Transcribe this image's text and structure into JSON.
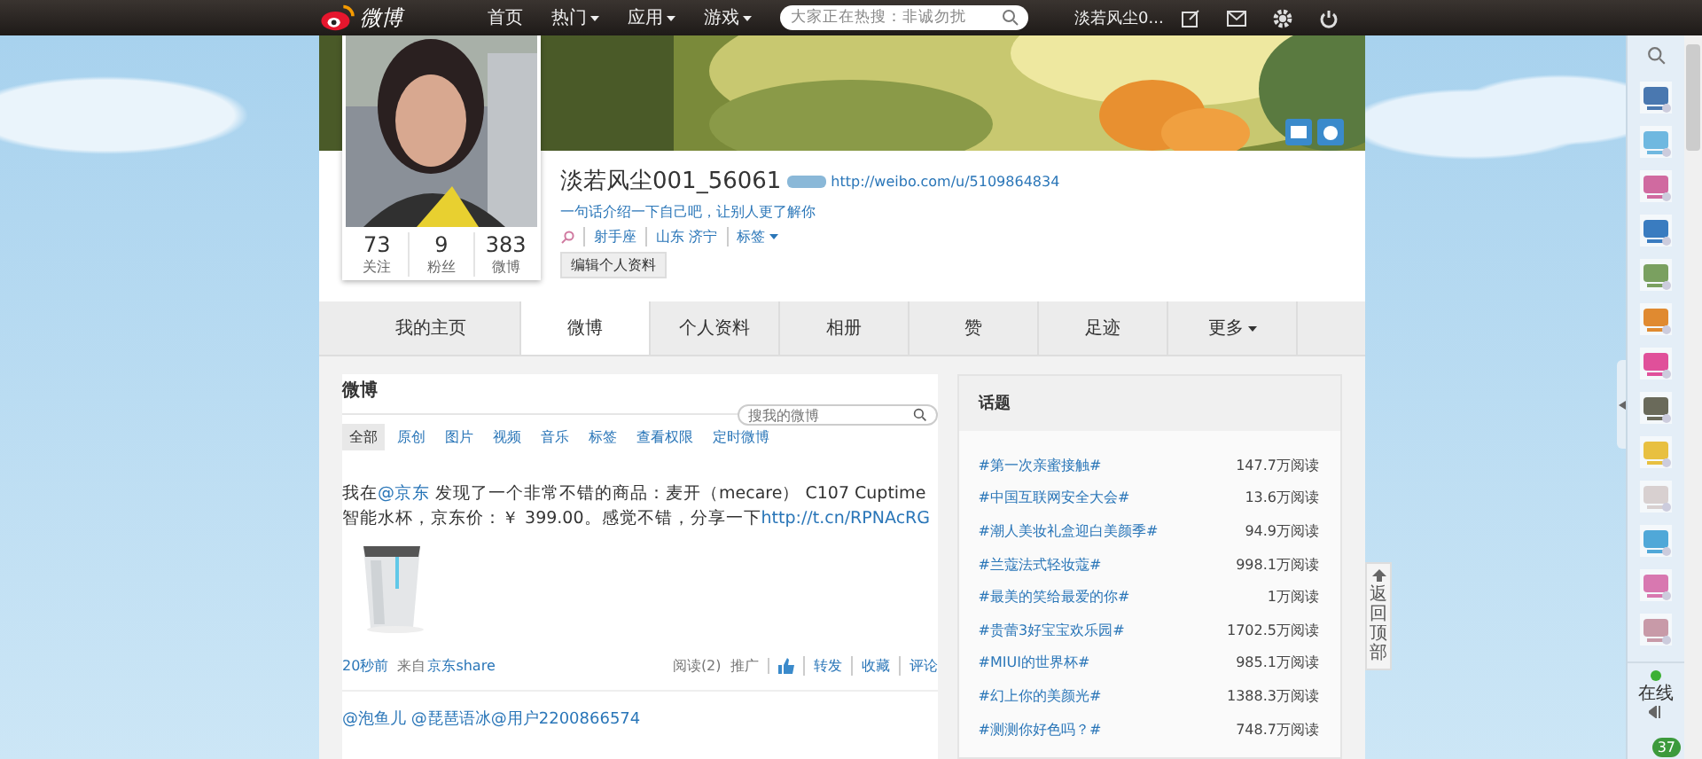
{
  "topbar": {
    "logo": "微博",
    "nav": [
      {
        "label": "首页",
        "dropdown": false
      },
      {
        "label": "热门",
        "dropdown": true
      },
      {
        "label": "应用",
        "dropdown": true
      },
      {
        "label": "游戏",
        "dropdown": true
      }
    ],
    "search": {
      "placeholder": "大家正在热搜：非诚勿扰"
    },
    "user": "淡若风尘0..."
  },
  "profile": {
    "name": "淡若风尘001_56061",
    "url": "http://weibo.com/u/5109864834",
    "bio": "一句话介绍一下自己吧，让别人更了解你",
    "details": [
      "射手座",
      "山东 济宁"
    ],
    "tags": "标签",
    "edit_button": "编辑个人资料",
    "stats": [
      {
        "value": "73",
        "label": "关注"
      },
      {
        "value": "9",
        "label": "粉丝"
      },
      {
        "value": "383",
        "label": "微博"
      }
    ]
  },
  "tabs": [
    {
      "label": "我的主页",
      "selected": false,
      "dropdown": false
    },
    {
      "label": "微博",
      "selected": true,
      "dropdown": false
    },
    {
      "label": "个人资料",
      "selected": false,
      "dropdown": false
    },
    {
      "label": "相册",
      "selected": false,
      "dropdown": false
    },
    {
      "label": "赞",
      "selected": false,
      "dropdown": false
    },
    {
      "label": "足迹",
      "selected": false,
      "dropdown": false
    },
    {
      "label": "更多",
      "selected": false,
      "dropdown": true
    }
  ],
  "feed": {
    "title": "微博",
    "search": {
      "placeholder": "搜我的微博"
    },
    "filters": [
      {
        "label": "全部",
        "selected": true
      },
      {
        "label": "原创",
        "selected": false
      },
      {
        "label": "图片",
        "selected": false
      },
      {
        "label": "视频",
        "selected": false
      },
      {
        "label": "音乐",
        "selected": false
      },
      {
        "label": "标签",
        "selected": false
      },
      {
        "label": "查看权限",
        "selected": false
      },
      {
        "label": "定时微博",
        "selected": false
      }
    ],
    "post": {
      "segments": [
        {
          "text": "我在",
          "link": false
        },
        {
          "text": "@京东",
          "link": true
        },
        {
          "text": " 发现了一个非常不错的商品：麦开（mecare） C107 Cuptime智能水杯，京东价：￥ 399.00。感觉不错，分享一下",
          "link": false
        },
        {
          "text": "http://t.cn/RPNAcRG",
          "link": true
        }
      ],
      "image": {
        "kind": "picture"
      },
      "time": "20秒前",
      "source_prefix": "来自",
      "source": "京东share",
      "reads": "阅读(2)",
      "promote": "推广",
      "actions": [
        "转发",
        "收藏",
        "评论"
      ]
    },
    "next_post": "@泡鱼儿 @琵琶语冰@用户2200866574"
  },
  "topics": {
    "title": "话题",
    "items": [
      {
        "name": "#第一次亲蜜接触#",
        "reads": "147.7万阅读"
      },
      {
        "name": "#中国互联网安全大会#",
        "reads": "13.6万阅读"
      },
      {
        "name": "#潮人美妆礼盒迎白美颜季#",
        "reads": "94.9万阅读"
      },
      {
        "name": "#兰蔻法式轻妆蔻#",
        "reads": "998.1万阅读"
      },
      {
        "name": "#最美的笑给最爱的你#",
        "reads": "1万阅读"
      },
      {
        "name": "#贵蕾3好宝宝欢乐园#",
        "reads": "1702.5万阅读"
      },
      {
        "name": "#MIUI的世界杯#",
        "reads": "985.1万阅读"
      },
      {
        "name": "#幻上你的美颜光#",
        "reads": "1388.3万阅读"
      },
      {
        "name": "#测测你好色吗？#",
        "reads": "748.7万阅读"
      }
    ]
  },
  "back_to_top": "返回顶部",
  "sidebar": {
    "apps": [
      {
        "color": "#4a78b0"
      },
      {
        "color": "#6fb8e0"
      },
      {
        "color": "#d06aa0"
      },
      {
        "color": "#3a7cc0"
      },
      {
        "color": "#7aa060"
      },
      {
        "color": "#e08a30"
      },
      {
        "color": "#e0509a"
      },
      {
        "color": "#6a6a5a"
      },
      {
        "color": "#e8c040"
      },
      {
        "color": "#d8d0d0"
      },
      {
        "color": "#50a8d8"
      },
      {
        "color": "#d878b0"
      },
      {
        "color": "#c89aa8"
      }
    ],
    "status": "在线",
    "badge": "37"
  }
}
